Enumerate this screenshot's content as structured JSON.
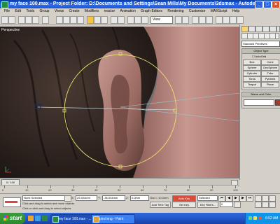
{
  "window": {
    "title": "my face 100.max    - Project Folder: D:\\Documents and Settings\\Sean Mills\\My Documents\\3dsmax    - Autodesk 3ds Max 9",
    "min_label": "_",
    "max_label": "□",
    "close_label": "×"
  },
  "menubar": [
    "File",
    "Edit",
    "Tools",
    "Group",
    "Views",
    "Create",
    "Modifiers",
    "reactor",
    "Animation",
    "Graph Editors",
    "Rendering",
    "Customize",
    "MAXScript",
    "Help"
  ],
  "toolbar": {
    "reference_coord": "View"
  },
  "viewport": {
    "label": "Perspective"
  },
  "command_panel": {
    "dropdown": "Standard Primitives",
    "object_type_header": "Object Type",
    "autogrid": "AutoGrid",
    "object_buttons": [
      "Box",
      "Cone",
      "Sphere",
      "GeoSphere",
      "Cylinder",
      "Tube",
      "Torus",
      "Pyramid",
      "Teapot",
      "Plane"
    ],
    "name_color_header": "Name and Color",
    "object_color": "#a33c2a"
  },
  "time_slider": {
    "label": "0 / 100"
  },
  "trackbar_ticks": [
    "0",
    "10",
    "20",
    "30",
    "40",
    "50",
    "60",
    "70",
    "80",
    "90",
    "100"
  ],
  "status": {
    "selection": "None Selected",
    "prompt": "Click and drag to select and move objects",
    "prompt2": "Click or click-and-drag to select objects",
    "x_label": "X:",
    "x_value": "29.404mm",
    "y_label": "Y:",
    "y_value": "-36.534mm",
    "z_label": "Z:",
    "z_value": "0.0mm",
    "grid": "Grid = 10.0mm",
    "add_time_tag": "Add Time Tag",
    "auto_key": "Auto Key",
    "set_key": "Set Key",
    "key_filters": "Key Filters...",
    "selected_dropdown": "Selected",
    "frame_value": "0"
  },
  "taskbar": {
    "start": "start",
    "items": [
      "my face 100.max - ...",
      "pinching - Paint"
    ],
    "clock": "6:52 AM"
  }
}
